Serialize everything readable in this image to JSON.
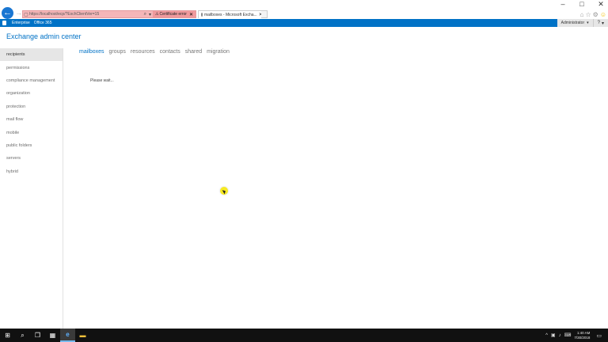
{
  "window": {
    "minimize": "–",
    "maximize": "□",
    "close": "✕"
  },
  "browser": {
    "back": "←",
    "forward": "→",
    "address_url": "https://localhost/ecp/?ExchClientVer=15",
    "address_host": "localhost",
    "cert_error": "Certificate error",
    "tab_title": "mailboxes - Microsoft Excha...",
    "tab_close": "✕"
  },
  "suite_bar": {
    "links": [
      "Enterprise",
      "Office 365"
    ],
    "user": "Administrator",
    "help": "?"
  },
  "app_title": "Exchange admin center",
  "left_nav": [
    {
      "label": "recipients",
      "active": true
    },
    {
      "label": "permissions"
    },
    {
      "label": "compliance management"
    },
    {
      "label": "organization"
    },
    {
      "label": "protection"
    },
    {
      "label": "mail flow"
    },
    {
      "label": "mobile"
    },
    {
      "label": "public folders"
    },
    {
      "label": "servers"
    },
    {
      "label": "hybrid"
    }
  ],
  "sub_tabs": [
    "mailboxes",
    "groups",
    "resources",
    "contacts",
    "shared",
    "migration"
  ],
  "status_text": "Please wait...",
  "taskbar": {
    "time": "1:40 AM",
    "date": "7/30/2018"
  }
}
